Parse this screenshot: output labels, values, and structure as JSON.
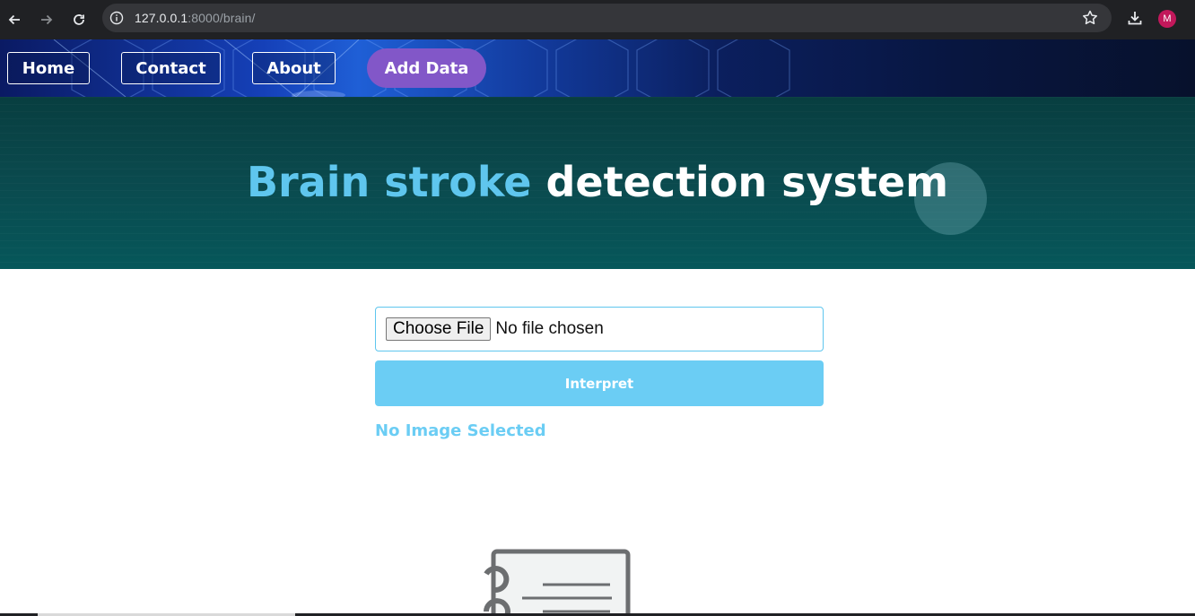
{
  "browser": {
    "url_host": "127.0.0.1",
    "url_path": ":8000/brain/",
    "profile_initial": "M"
  },
  "nav": {
    "home": "Home",
    "contact": "Contact",
    "about": "About",
    "add_data": "Add Data"
  },
  "hero": {
    "title_accent": "Brain stroke",
    "title_rest": " detection system"
  },
  "form": {
    "choose_file": "Choose File",
    "no_file": "No file chosen",
    "interpret": "Interpret",
    "status": "No Image Selected"
  },
  "colors": {
    "accent": "#5fc6ee",
    "button": "#6bcdf4",
    "add_data_bg": "#8257c8",
    "hero_bg": "#0a4a4e"
  }
}
